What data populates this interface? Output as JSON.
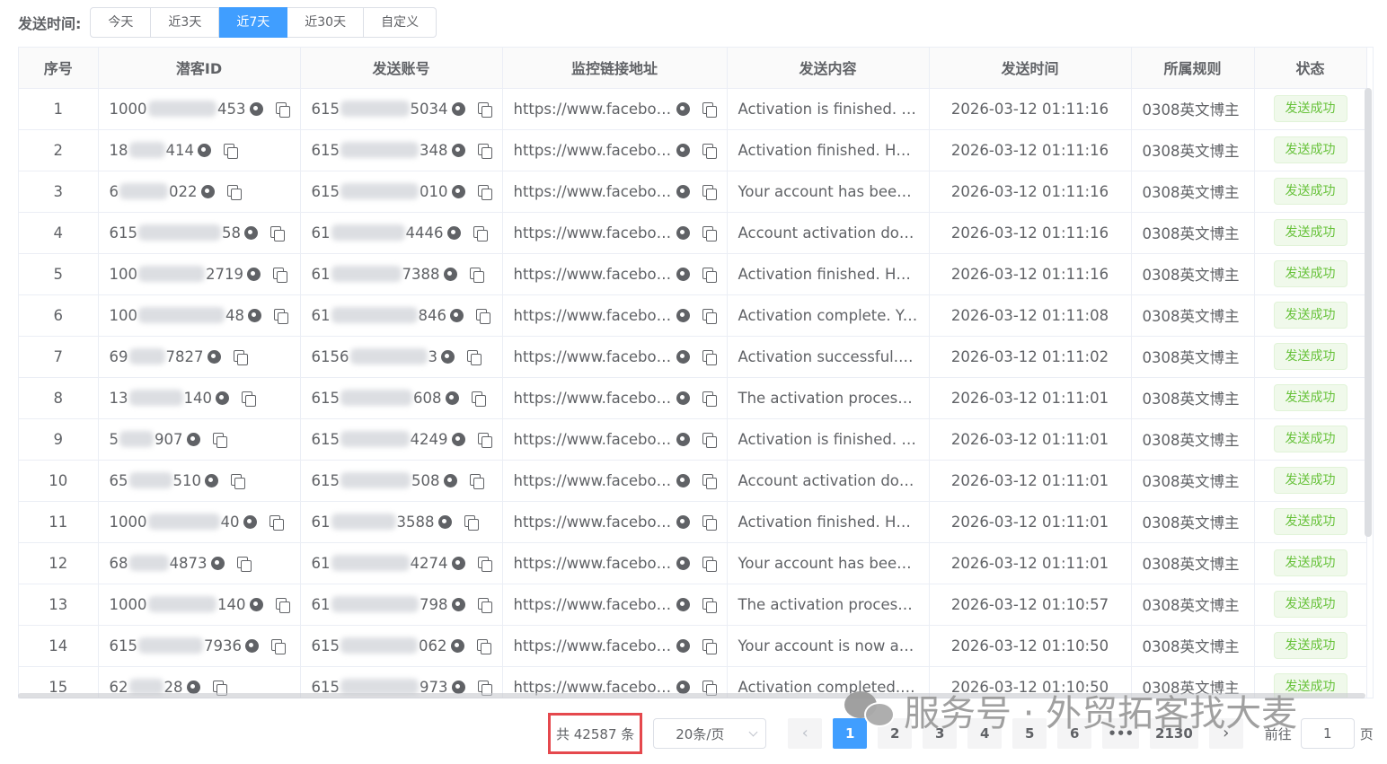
{
  "filter": {
    "label": "发送时间:",
    "options": [
      "今天",
      "近3天",
      "近7天",
      "近30天",
      "自定义"
    ],
    "active": 2
  },
  "table": {
    "columns": [
      "序号",
      "潜客ID",
      "发送账号",
      "监控链接地址",
      "发送内容",
      "发送时间",
      "所属规则",
      "状态"
    ],
    "rows": [
      {
        "no": "1",
        "id_a": "1000",
        "id_b": "453",
        "acc_a": "615",
        "acc_b": "5034",
        "url": "https://www.faceboo…",
        "content": "Activation is finished. Y…",
        "time": "2026-03-12 01:11:16",
        "rule": "0308英文博主",
        "status": "发送成功"
      },
      {
        "no": "2",
        "id_a": "18",
        "id_b": "414",
        "acc_a": "615",
        "acc_b": "348",
        "url": "https://www.faceboo…",
        "content": "Activation finished. Her…",
        "time": "2026-03-12 01:11:16",
        "rule": "0308英文博主",
        "status": "发送成功"
      },
      {
        "no": "3",
        "id_a": "6",
        "id_b": "022",
        "acc_a": "615",
        "acc_b": "010",
        "url": "https://www.faceboo…",
        "content": "Your account has been…",
        "time": "2026-03-12 01:11:16",
        "rule": "0308英文博主",
        "status": "发送成功"
      },
      {
        "no": "4",
        "id_a": "615",
        "id_b": "58",
        "acc_a": "61",
        "acc_b": "4446",
        "url": "https://www.faceboo…",
        "content": "Account activation don…",
        "time": "2026-03-12 01:11:16",
        "rule": "0308英文博主",
        "status": "发送成功"
      },
      {
        "no": "5",
        "id_a": "100",
        "id_b": "2719",
        "acc_a": "61",
        "acc_b": "7388",
        "url": "https://www.faceboo…",
        "content": "Activation finished. Her…",
        "time": "2026-03-12 01:11:16",
        "rule": "0308英文博主",
        "status": "发送成功"
      },
      {
        "no": "6",
        "id_a": "100",
        "id_b": "48",
        "acc_a": "61",
        "acc_b": "846",
        "url": "https://www.faceboo…",
        "content": "Activation complete. Yo…",
        "time": "2026-03-12 01:11:08",
        "rule": "0308英文博主",
        "status": "发送成功"
      },
      {
        "no": "7",
        "id_a": "69",
        "id_b": "7827",
        "acc_a": "6156",
        "acc_b": "3",
        "url": "https://www.faceboo…",
        "content": "Activation successful. …",
        "time": "2026-03-12 01:11:02",
        "rule": "0308英文博主",
        "status": "发送成功"
      },
      {
        "no": "8",
        "id_a": "13",
        "id_b": "140",
        "acc_a": "615",
        "acc_b": "608",
        "url": "https://www.faceboo…",
        "content": "The activation process …",
        "time": "2026-03-12 01:11:01",
        "rule": "0308英文博主",
        "status": "发送成功"
      },
      {
        "no": "9",
        "id_a": "5",
        "id_b": "907",
        "acc_a": "615",
        "acc_b": "4249",
        "url": "https://www.faceboo…",
        "content": "Activation is finished. Y…",
        "time": "2026-03-12 01:11:01",
        "rule": "0308英文博主",
        "status": "发送成功"
      },
      {
        "no": "10",
        "id_a": "65",
        "id_b": "510",
        "acc_a": "615",
        "acc_b": "508",
        "url": "https://www.faceboo…",
        "content": "Account activation don…",
        "time": "2026-03-12 01:11:01",
        "rule": "0308英文博主",
        "status": "发送成功"
      },
      {
        "no": "11",
        "id_a": "1000",
        "id_b": "40",
        "acc_a": "61",
        "acc_b": "3588",
        "url": "https://www.faceboo…",
        "content": "Activation finished. Her…",
        "time": "2026-03-12 01:11:01",
        "rule": "0308英文博主",
        "status": "发送成功"
      },
      {
        "no": "12",
        "id_a": "68",
        "id_b": "4873",
        "acc_a": "61",
        "acc_b": "4274",
        "url": "https://www.faceboo…",
        "content": "Your account has been…",
        "time": "2026-03-12 01:11:01",
        "rule": "0308英文博主",
        "status": "发送成功"
      },
      {
        "no": "13",
        "id_a": "1000",
        "id_b": "140",
        "acc_a": "61",
        "acc_b": "798",
        "url": "https://www.faceboo…",
        "content": "The activation process …",
        "time": "2026-03-12 01:10:57",
        "rule": "0308英文博主",
        "status": "发送成功"
      },
      {
        "no": "14",
        "id_a": "615",
        "id_b": "7936",
        "acc_a": "615",
        "acc_b": "062",
        "url": "https://www.faceboo…",
        "content": "Your account is now ac…",
        "time": "2026-03-12 01:10:50",
        "rule": "0308英文博主",
        "status": "发送成功"
      },
      {
        "no": "15",
        "id_a": "62",
        "id_b": "28",
        "acc_a": "615",
        "acc_b": "973",
        "url": "https://www.faceboo…",
        "content": "Activation completed. …",
        "time": "2026-03-12 01:10:50",
        "rule": "0308英文博主",
        "status": "发送成功"
      }
    ]
  },
  "pagination": {
    "total": "共 42587 条",
    "page_size": "20条/页",
    "pages": [
      "1",
      "2",
      "3",
      "4",
      "5",
      "6",
      "•••",
      "2130"
    ],
    "active_page": "1",
    "goto_prefix": "前往",
    "goto_value": "1",
    "goto_suffix": "页"
  },
  "watermark": "服务号 · 外贸拓客找大麦"
}
